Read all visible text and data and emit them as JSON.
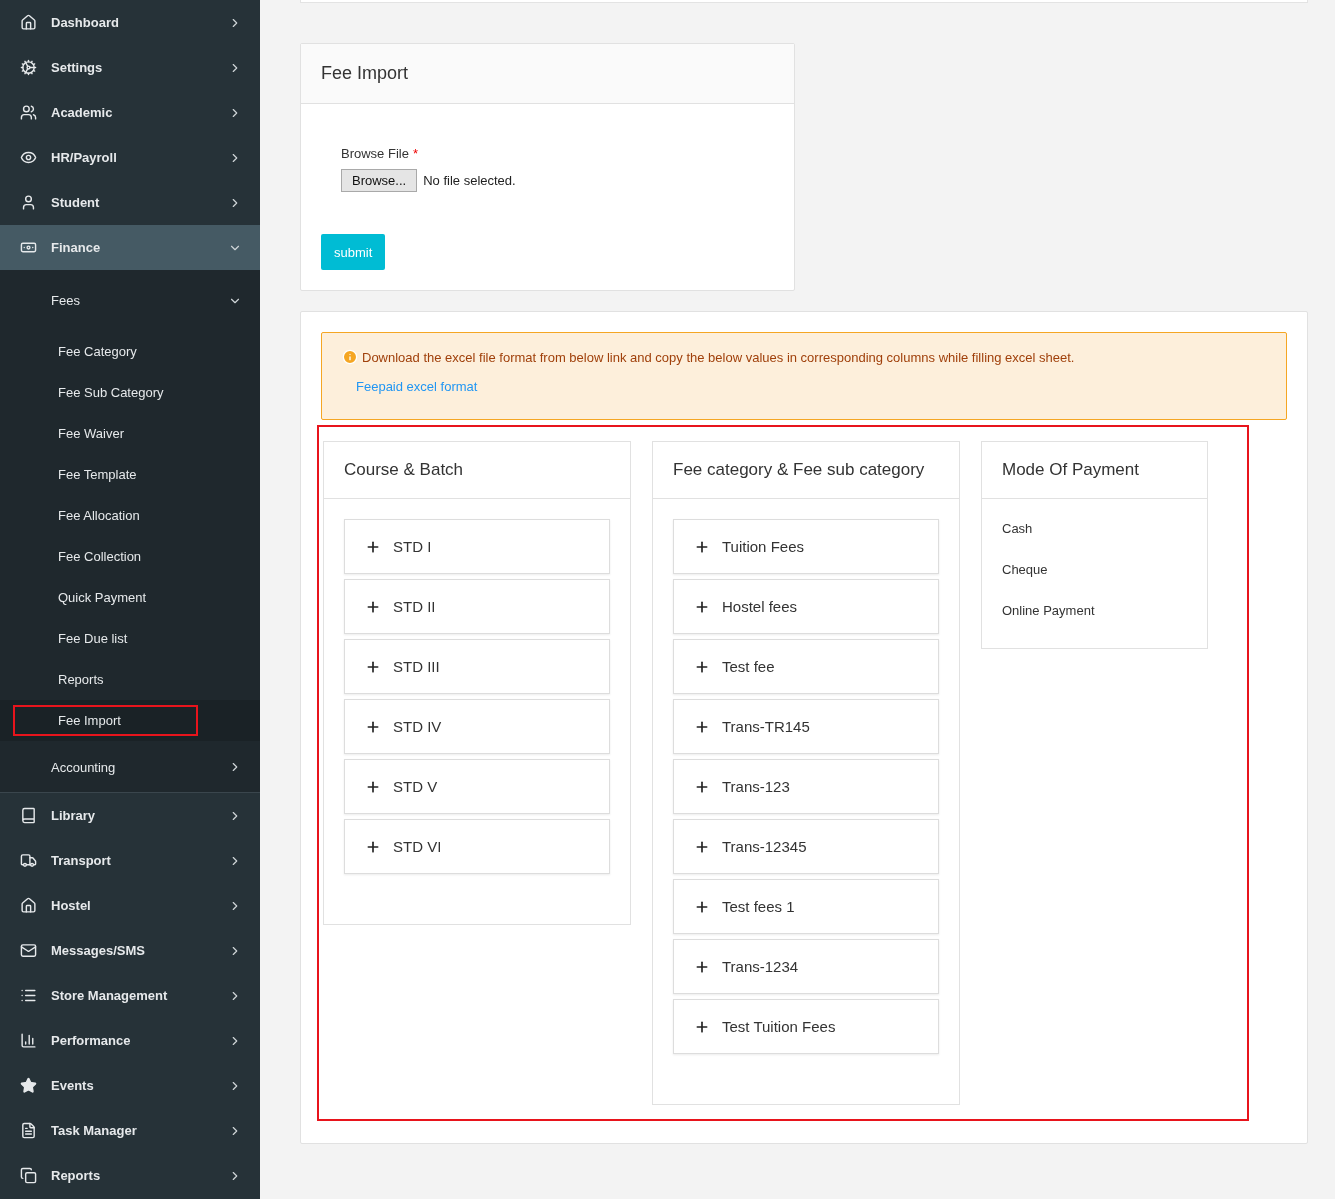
{
  "sidebar": {
    "items": [
      {
        "label": "Dashboard",
        "expanded": false
      },
      {
        "label": "Settings",
        "expanded": false
      },
      {
        "label": "Academic",
        "expanded": false
      },
      {
        "label": "HR/Payroll",
        "expanded": false
      },
      {
        "label": "Student",
        "expanded": false
      },
      {
        "label": "Finance",
        "expanded": true,
        "children": [
          {
            "label": "Fees",
            "expanded": true,
            "children": [
              {
                "label": "Fee Category",
                "selected": false
              },
              {
                "label": "Fee Sub Category",
                "selected": false
              },
              {
                "label": "Fee Waiver",
                "selected": false
              },
              {
                "label": "Fee Template",
                "selected": false
              },
              {
                "label": "Fee Allocation",
                "selected": false
              },
              {
                "label": "Fee Collection",
                "selected": false
              },
              {
                "label": "Quick Payment",
                "selected": false
              },
              {
                "label": "Fee Due list",
                "selected": false
              },
              {
                "label": "Reports",
                "selected": false
              },
              {
                "label": "Fee Import",
                "selected": true
              }
            ]
          },
          {
            "label": "Accounting",
            "expanded": false
          }
        ]
      },
      {
        "label": "Library",
        "expanded": false
      },
      {
        "label": "Transport",
        "expanded": false
      },
      {
        "label": "Hostel",
        "expanded": false
      },
      {
        "label": "Messages/SMS",
        "expanded": false
      },
      {
        "label": "Store Management",
        "expanded": false
      },
      {
        "label": "Performance",
        "expanded": false
      },
      {
        "label": "Events",
        "expanded": false
      },
      {
        "label": "Task Manager",
        "expanded": false
      },
      {
        "label": "Reports",
        "expanded": false
      }
    ]
  },
  "import_card": {
    "title": "Fee Import",
    "field_label": "Browse File",
    "required_mark": "*",
    "browse_button": "Browse...",
    "file_status": "No file selected.",
    "submit": "submit"
  },
  "info_card": {
    "alert": {
      "text": "Download the excel file format from below link and copy the below values in corresponding columns while filling excel sheet.",
      "link": "Feepaid excel format"
    },
    "panels": [
      {
        "title": "Course & Batch",
        "kind": "accordion",
        "items": [
          "STD I",
          "STD II",
          "STD III",
          "STD IV",
          "STD V",
          "STD VI"
        ]
      },
      {
        "title": "Fee category & Fee sub category",
        "kind": "accordion",
        "items": [
          "Tuition Fees",
          "Hostel fees",
          "Test fee",
          "Trans-TR145",
          "Trans-123",
          "Trans-12345",
          "Test fees 1",
          "Trans-1234",
          "Test Tuition Fees"
        ]
      },
      {
        "title": "Mode Of Payment",
        "kind": "list",
        "items": [
          "Cash",
          "Cheque",
          "Online Payment"
        ]
      }
    ]
  }
}
